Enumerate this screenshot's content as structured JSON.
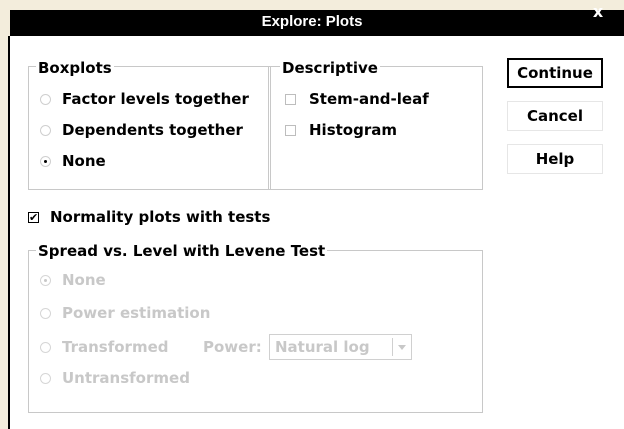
{
  "window": {
    "title": "Explore: Plots",
    "close_glyph": "x"
  },
  "boxplots": {
    "label": "Boxplots",
    "options": [
      {
        "label": "Factor levels together",
        "selected": false
      },
      {
        "label": "Dependents together",
        "selected": false
      },
      {
        "label": "None",
        "selected": true
      }
    ]
  },
  "descriptive": {
    "label": "Descriptive",
    "options": [
      {
        "label": "Stem-and-leaf",
        "checked": false
      },
      {
        "label": "Histogram",
        "checked": false
      }
    ]
  },
  "buttons": {
    "continue": "Continue",
    "cancel": "Cancel",
    "help": "Help"
  },
  "normality": {
    "label": "Normality plots with tests",
    "checked": true
  },
  "spread": {
    "label": "Spread vs. Level with Levene Test",
    "enabled": false,
    "options": [
      {
        "label": "None",
        "selected": true
      },
      {
        "label": "Power estimation",
        "selected": false
      },
      {
        "label": "Transformed",
        "selected": false
      },
      {
        "label": "Untransformed",
        "selected": false
      }
    ],
    "power_label": "Power:",
    "power_value": "Natural log"
  }
}
